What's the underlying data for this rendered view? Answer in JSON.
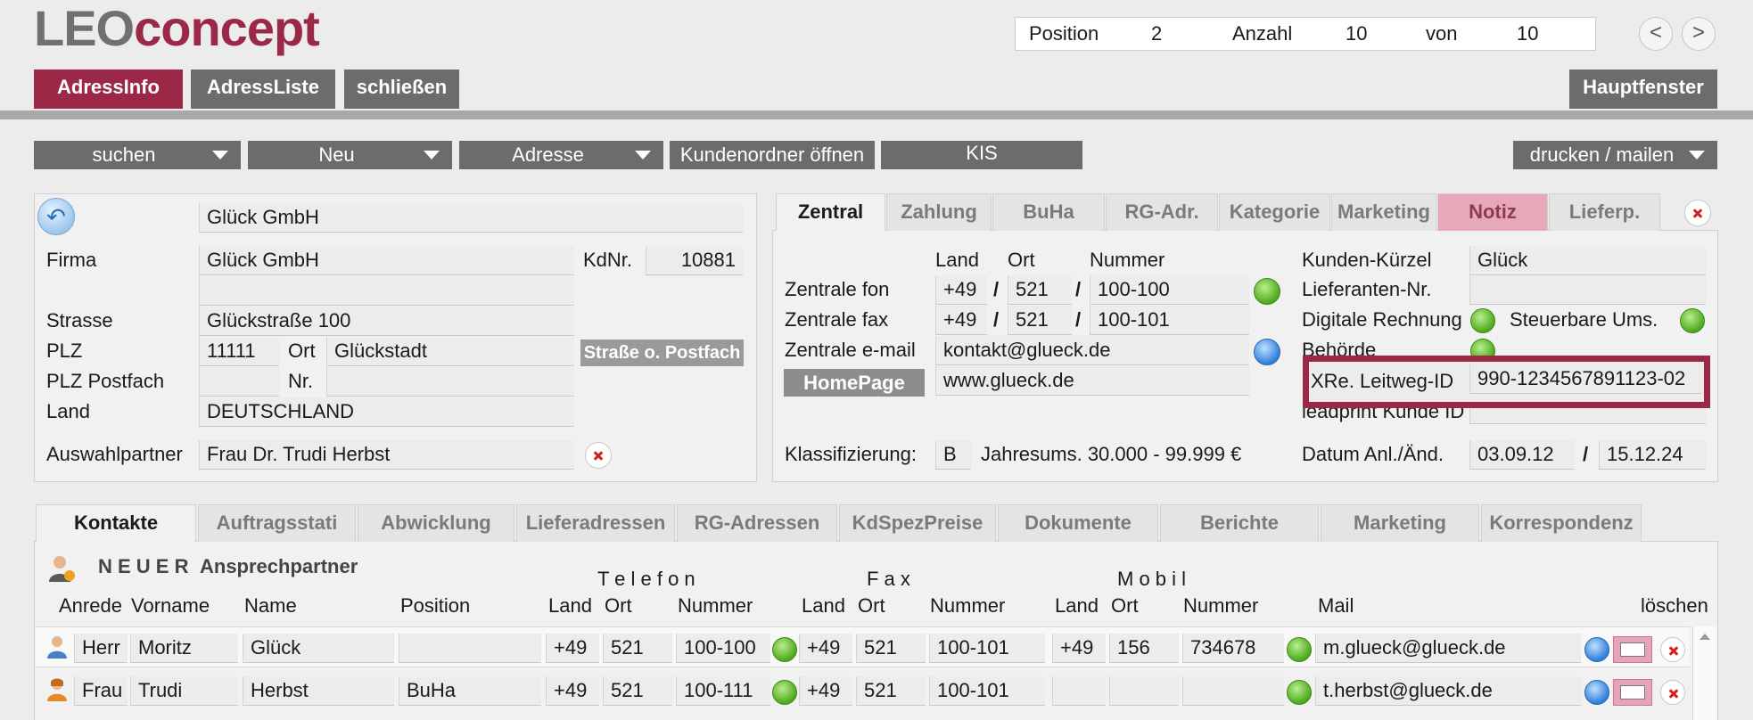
{
  "app": {
    "logo_gray": "LEO",
    "logo_red": "concept"
  },
  "nav": {
    "position_label": "Position",
    "position_value": "2",
    "anzahl_label": "Anzahl",
    "anzahl_value": "10",
    "von_label": "von",
    "von_value": "10",
    "prev": "<",
    "next": ">"
  },
  "main_tabs": {
    "adressinfo": "AdressInfo",
    "adressliste": "AdressListe",
    "schliessen": "schließen",
    "hauptfenster": "Hauptfenster"
  },
  "toolbar": {
    "suchen": "suchen",
    "neu": "Neu",
    "adresse": "Adresse",
    "kundenordner": "Kundenordner öffnen",
    "kis": "KIS",
    "drucken": "drucken / mailen"
  },
  "address": {
    "name_header": "Glück GmbH",
    "firma_label": "Firma",
    "firma": "Glück GmbH",
    "kdnr_label": "KdNr.",
    "kdnr": "10881",
    "strasse_label": "Strasse",
    "strasse": "Glückstraße 100",
    "plz_label": "PLZ",
    "plz": "11111",
    "ort_label": "Ort",
    "ort": "Glückstadt",
    "strasse_postfach_button": "Straße o. Postfach",
    "plz_postfach_label": "PLZ Postfach",
    "nr_label": "Nr.",
    "land_label": "Land",
    "land": "DEUTSCHLAND",
    "auswahlpartner_label": "Auswahlpartner",
    "auswahlpartner": "Frau Dr. Trudi Herbst"
  },
  "right_tabs": [
    "Zentral",
    "Zahlung",
    "BuHa",
    "RG-Adr.",
    "Kategorie",
    "Marketing",
    "Notiz",
    "Lieferp."
  ],
  "zentral": {
    "col_land": "Land",
    "col_ort": "Ort",
    "col_nummer": "Nummer",
    "fon_label": "Zentrale fon",
    "fon_land": "+49",
    "fon_ort": "521",
    "fon_nummer": "100-100",
    "fax_label": "Zentrale fax",
    "fax_land": "+49",
    "fax_ort": "521",
    "fax_nummer": "100-101",
    "email_label": "Zentrale e-mail",
    "email": "kontakt@glueck.de",
    "homepage_button": "HomePage",
    "homepage": "www.glueck.de",
    "klass_label": "Klassifizierung:",
    "klass": "B",
    "jahresums": "Jahresums. 30.000 - 99.999 €",
    "kuerzel_label": "Kunden-Kürzel",
    "kuerzel": "Glück",
    "lieferanten_label": "Lieferanten-Nr.",
    "digitale_label": "Digitale Rechnung",
    "steuerbare_label": "Steuerbare Ums.",
    "behoerde_label": "Behörde",
    "leitweg_label": "XRe. Leitweg-ID",
    "leitweg": "990-1234567891123-02",
    "leadprint_label": "leadprint Kunde ID",
    "datum_label": "Datum Anl./Änd.",
    "datum_anl": "03.09.12",
    "datum_aend": "15.12.24",
    "slash": "/"
  },
  "bottom_tabs": [
    "Kontakte",
    "Auftragsstati",
    "Abwicklung",
    "Lieferadressen",
    "RG-Adressen",
    "KdSpezPreise",
    "Dokumente",
    "Berichte",
    "Marketing",
    "Korrespondenz"
  ],
  "contacts": {
    "new_label": "N E U E R",
    "new_label2": "Ansprechpartner",
    "group_telefon": "T e l e f o n",
    "group_fax": "F a x",
    "group_mobil": "M o b i l",
    "headers": {
      "anrede": "Anrede",
      "vorname": "Vorname",
      "name": "Name",
      "position": "Position",
      "land": "Land",
      "ort": "Ort",
      "nummer": "Nummer",
      "mail": "Mail",
      "loeschen": "löschen"
    },
    "rows": [
      {
        "anrede": "Herr",
        "vorname": "Moritz",
        "name": "Glück",
        "position": "",
        "tel_land": "+49",
        "tel_ort": "521",
        "tel_nr": "100-100",
        "fax_land": "+49",
        "fax_ort": "521",
        "fax_nr": "100-101",
        "mob_land": "+49",
        "mob_ort": "156",
        "mob_nr": "734678",
        "mail": "m.glueck@glueck.de"
      },
      {
        "anrede": "Frau",
        "vorname": "Trudi",
        "name": "Herbst",
        "position": "BuHa",
        "tel_land": "+49",
        "tel_ort": "521",
        "tel_nr": "100-111",
        "fax_land": "+49",
        "fax_ort": "521",
        "fax_nr": "100-101",
        "mob_land": "",
        "mob_ort": "",
        "mob_nr": "",
        "mail": "t.herbst@glueck.de"
      }
    ]
  },
  "colors": {
    "accent": "#9b2846",
    "button_gray": "#6c6c6c",
    "notiz_tab": "#e7a9b8"
  }
}
